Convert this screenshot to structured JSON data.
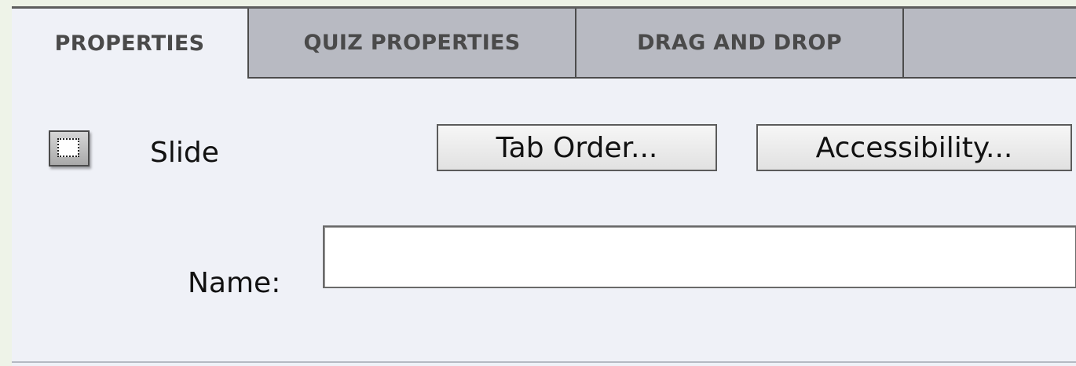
{
  "tabs": [
    {
      "label": "PROPERTIES",
      "active": true
    },
    {
      "label": "QUIZ PROPERTIES",
      "active": false
    },
    {
      "label": "DRAG AND DROP",
      "active": false
    }
  ],
  "object": {
    "icon": "slide-icon",
    "type_label": "Slide"
  },
  "buttons": {
    "tab_order": "Tab Order...",
    "accessibility": "Accessibility..."
  },
  "name_field": {
    "label": "Name:",
    "value": "",
    "placeholder": ""
  },
  "colors": {
    "panel_bg": "#eff1f7",
    "inactive_tab_bg": "#b8bac2",
    "border": "#4c4c4c"
  }
}
